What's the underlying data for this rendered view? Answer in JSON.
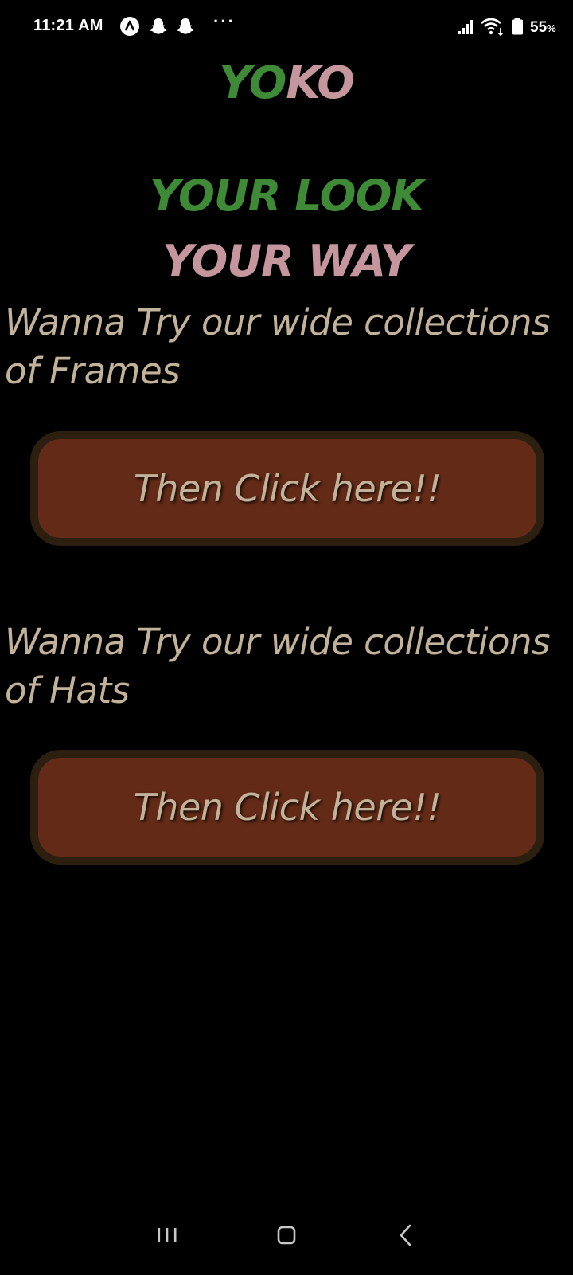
{
  "status_bar": {
    "time": "11:21 AM",
    "dots": "···",
    "battery_value": "55",
    "battery_unit": "%",
    "icons": [
      "app-a-icon",
      "snapchat-icon",
      "snapchat-icon",
      "signal-icon",
      "wifi-icon",
      "battery-icon"
    ]
  },
  "header": {
    "logo_part1": "YO",
    "logo_part2": "KO",
    "tagline_line1": "YOUR LOOK",
    "tagline_line2": "YOUR WAY"
  },
  "sections": {
    "frames": {
      "prompt": "Wanna Try our wide collections of Frames",
      "button_label": "Then Click here!!"
    },
    "hats": {
      "prompt": "Wanna Try our wide collections of Hats",
      "button_label": "Then Click here!!"
    }
  },
  "nav_bar": {
    "icons": [
      "recent-apps-icon",
      "home-icon",
      "back-icon"
    ]
  },
  "colors": {
    "background": "#000000",
    "green": "#3e8a36",
    "pink": "#c6969e",
    "text": "#c2b29a",
    "button_fill": "#622a17",
    "button_border": "#2c1f10"
  }
}
